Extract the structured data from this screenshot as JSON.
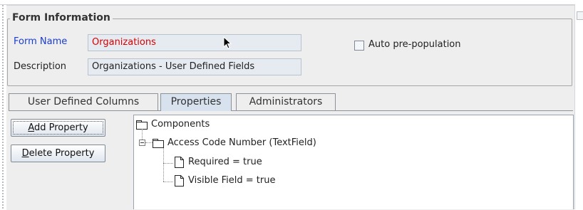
{
  "group": {
    "title": "Form Information",
    "form_name_label": "Form Name",
    "form_name_value": "Organizations",
    "description_label": "Description",
    "description_value": "Organizations - User Defined Fields",
    "auto_prepopulation_label": "Auto pre-population",
    "auto_prepopulation_checked": false
  },
  "tabs": [
    {
      "label": "User Defined  Columns",
      "active": false
    },
    {
      "label": "Properties",
      "active": true
    },
    {
      "label": "Administrators",
      "active": false
    }
  ],
  "buttons": {
    "add_property_prefix": "A",
    "add_property_rest": "dd Property",
    "delete_property_prefix": "D",
    "delete_property_rest": "elete Property"
  },
  "tree": {
    "root": "Components",
    "child": "Access Code Number (TextField)",
    "leaves": [
      "Required = true",
      "Visible Field = true"
    ]
  },
  "colors": {
    "accent_label": "#1a3ccf",
    "error_value": "#d90000",
    "active_tab": "#d7e2ee"
  },
  "icons": [
    "folder-icon",
    "file-icon",
    "collapse-icon",
    "mouse-cursor-icon"
  ]
}
